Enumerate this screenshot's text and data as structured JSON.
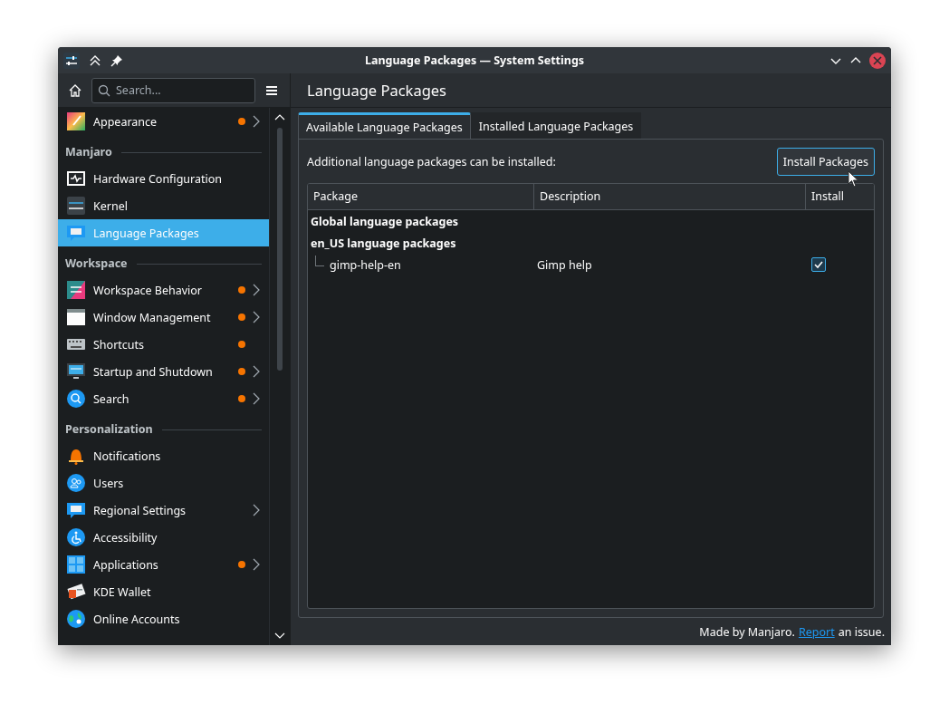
{
  "window": {
    "title": "Language Packages — System Settings"
  },
  "sidebar": {
    "search": {
      "placeholder": "Search..."
    },
    "items": [
      {
        "kind": "item",
        "label": "Appearance",
        "selected": false,
        "modified": true,
        "has_children": true
      },
      {
        "kind": "section",
        "label": "Manjaro"
      },
      {
        "kind": "item",
        "label": "Hardware Configuration",
        "selected": false,
        "modified": false,
        "has_children": false
      },
      {
        "kind": "item",
        "label": "Kernel",
        "selected": false,
        "modified": false,
        "has_children": false
      },
      {
        "kind": "item",
        "label": "Language Packages",
        "selected": true,
        "modified": false,
        "has_children": false
      },
      {
        "kind": "section",
        "label": "Workspace"
      },
      {
        "kind": "item",
        "label": "Workspace Behavior",
        "selected": false,
        "modified": true,
        "has_children": true
      },
      {
        "kind": "item",
        "label": "Window Management",
        "selected": false,
        "modified": true,
        "has_children": true
      },
      {
        "kind": "item",
        "label": "Shortcuts",
        "selected": false,
        "modified": true,
        "has_children": false
      },
      {
        "kind": "item",
        "label": "Startup and Shutdown",
        "selected": false,
        "modified": true,
        "has_children": true
      },
      {
        "kind": "item",
        "label": "Search",
        "selected": false,
        "modified": true,
        "has_children": true
      },
      {
        "kind": "section",
        "label": "Personalization"
      },
      {
        "kind": "item",
        "label": "Notifications",
        "selected": false,
        "modified": false,
        "has_children": false
      },
      {
        "kind": "item",
        "label": "Users",
        "selected": false,
        "modified": false,
        "has_children": false
      },
      {
        "kind": "item",
        "label": "Regional Settings",
        "selected": false,
        "modified": false,
        "has_children": true
      },
      {
        "kind": "item",
        "label": "Accessibility",
        "selected": false,
        "modified": false,
        "has_children": false
      },
      {
        "kind": "item",
        "label": "Applications",
        "selected": false,
        "modified": true,
        "has_children": true
      },
      {
        "kind": "item",
        "label": "KDE Wallet",
        "selected": false,
        "modified": false,
        "has_children": false
      },
      {
        "kind": "item",
        "label": "Online Accounts",
        "selected": false,
        "modified": false,
        "has_children": false
      }
    ]
  },
  "page": {
    "title": "Language Packages",
    "tabs": [
      {
        "label": "Available Language Packages",
        "selected": true
      },
      {
        "label": "Installed Language Packages",
        "selected": false
      }
    ],
    "intro": "Additional language packages can be installed:",
    "install_button": "Install Packages",
    "table": {
      "columns": [
        "Package",
        "Description",
        "Install"
      ],
      "rows": [
        {
          "kind": "group",
          "label": "Global language packages"
        },
        {
          "kind": "group",
          "label": "en_US language packages"
        },
        {
          "kind": "package",
          "package": "gimp-help-en",
          "description": "Gimp help",
          "checked": true
        }
      ]
    }
  },
  "footer": {
    "text": "Made by Manjaro.",
    "link": "Report",
    "suffix": "an issue."
  }
}
